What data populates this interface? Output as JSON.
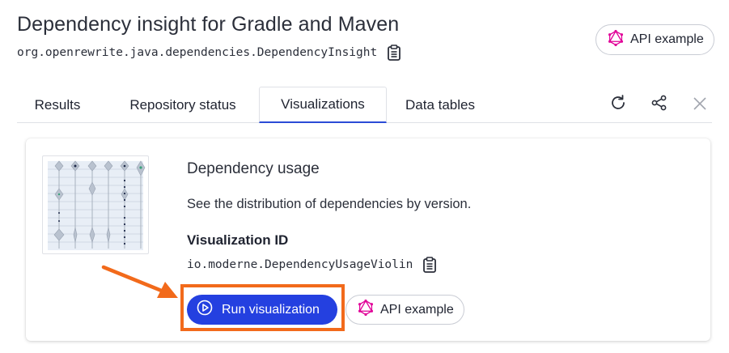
{
  "header": {
    "title": "Dependency insight for Gradle and Maven",
    "recipe_id": "org.openrewrite.java.dependencies.DependencyInsight",
    "api_example_label": "API example"
  },
  "tabs": [
    {
      "label": "Results",
      "active": false
    },
    {
      "label": "Repository status",
      "active": false
    },
    {
      "label": "Visualizations",
      "active": true
    },
    {
      "label": "Data tables",
      "active": false
    }
  ],
  "tab_actions": [
    "refresh-icon",
    "share-icon",
    "close-icon"
  ],
  "card": {
    "title": "Dependency usage",
    "description": "See the distribution of dependencies by version.",
    "viz_id_label": "Visualization ID",
    "viz_id": "io.moderne.DependencyUsageViolin",
    "run_label": "Run visualization",
    "api_example_label": "API example"
  },
  "colors": {
    "accent": "#2440e0",
    "highlight": "#f26a1b",
    "graphql": "#e10098"
  }
}
